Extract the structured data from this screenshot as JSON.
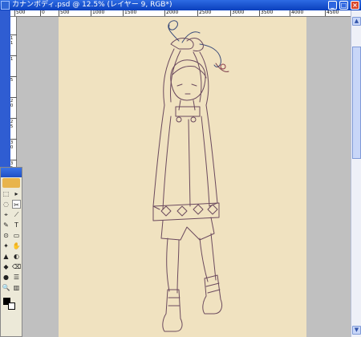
{
  "window": {
    "title": "カナンボディ.psd @ 12.5% (レイヤー 9, RGB*)",
    "buttons": {
      "minimize": "_",
      "maximize": "□",
      "close": "×"
    }
  },
  "ruler": {
    "top_labels": [
      "500",
      "0",
      "500",
      "1000",
      "1500",
      "2000",
      "2500",
      "3000",
      "3500",
      "4000",
      "4500"
    ],
    "left_labels": [
      "1",
      "1",
      "1",
      "5",
      "2",
      "0",
      "2",
      "5",
      "3",
      "0",
      "3",
      "5",
      "4",
      "0"
    ]
  },
  "scrollbar": {
    "up": "▲",
    "down": "▼"
  },
  "toolbox": {
    "tools": [
      "⬚",
      "▸",
      "◌",
      "✂",
      "⌖",
      "⟋",
      "✎",
      "T",
      "⊙",
      "▭",
      "✦",
      "✋",
      "▲",
      "◐",
      "◆",
      "⌫",
      "●",
      "☰",
      "🔍",
      "▥"
    ]
  },
  "colors": {
    "document": "#f0e2c0",
    "pasteboard": "#c0c0c0",
    "titlebar": "#1f52cc"
  }
}
